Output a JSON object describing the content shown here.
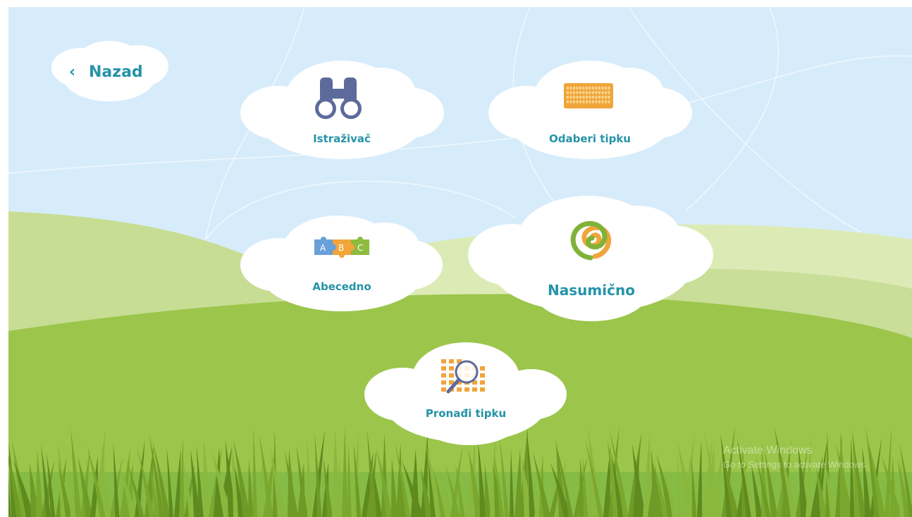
{
  "nav": {
    "back_label": "Nazad",
    "back_chevron": "‹"
  },
  "menu": {
    "explorer": {
      "label": "Istraživač",
      "icon": "binoculars-icon"
    },
    "select_key": {
      "label": "Odaberi tipku",
      "icon": "keyboard-icon"
    },
    "alphabetical": {
      "label": "Abecedno",
      "icon": "puzzle-abc-icon",
      "puzzle_letters": [
        "A",
        "B",
        "C"
      ]
    },
    "random": {
      "label": "Nasumično",
      "icon": "spiral-icon"
    },
    "find_key": {
      "label": "Pronađi tipku",
      "icon": "magnifier-keyboard-icon"
    }
  },
  "watermark": {
    "line1": "Activate Windows",
    "line2": "Go to Settings to activate Windows."
  },
  "colors": {
    "sky": "#d7ecfb",
    "label": "#2593a8",
    "hill_far": "#c7dd93",
    "hill_near": "#9cc54c",
    "grass_dark": "#6f9a26",
    "cloud": "#ffffff"
  }
}
